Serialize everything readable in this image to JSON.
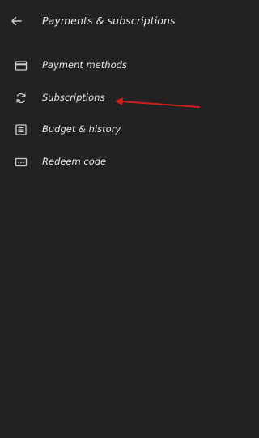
{
  "header": {
    "title": "Payments & subscriptions",
    "back_icon": "arrow-left-icon"
  },
  "menu": {
    "items": [
      {
        "label": "Payment methods",
        "icon": "credit-card-icon"
      },
      {
        "label": "Subscriptions",
        "icon": "refresh-icon"
      },
      {
        "label": "Budget & history",
        "icon": "list-icon"
      },
      {
        "label": "Redeem code",
        "icon": "gift-card-icon"
      }
    ]
  },
  "colors": {
    "background": "#222222",
    "text": "#e6e6e6",
    "icon": "#cfcfcf",
    "annotation_arrow": "#cc1f1f"
  }
}
